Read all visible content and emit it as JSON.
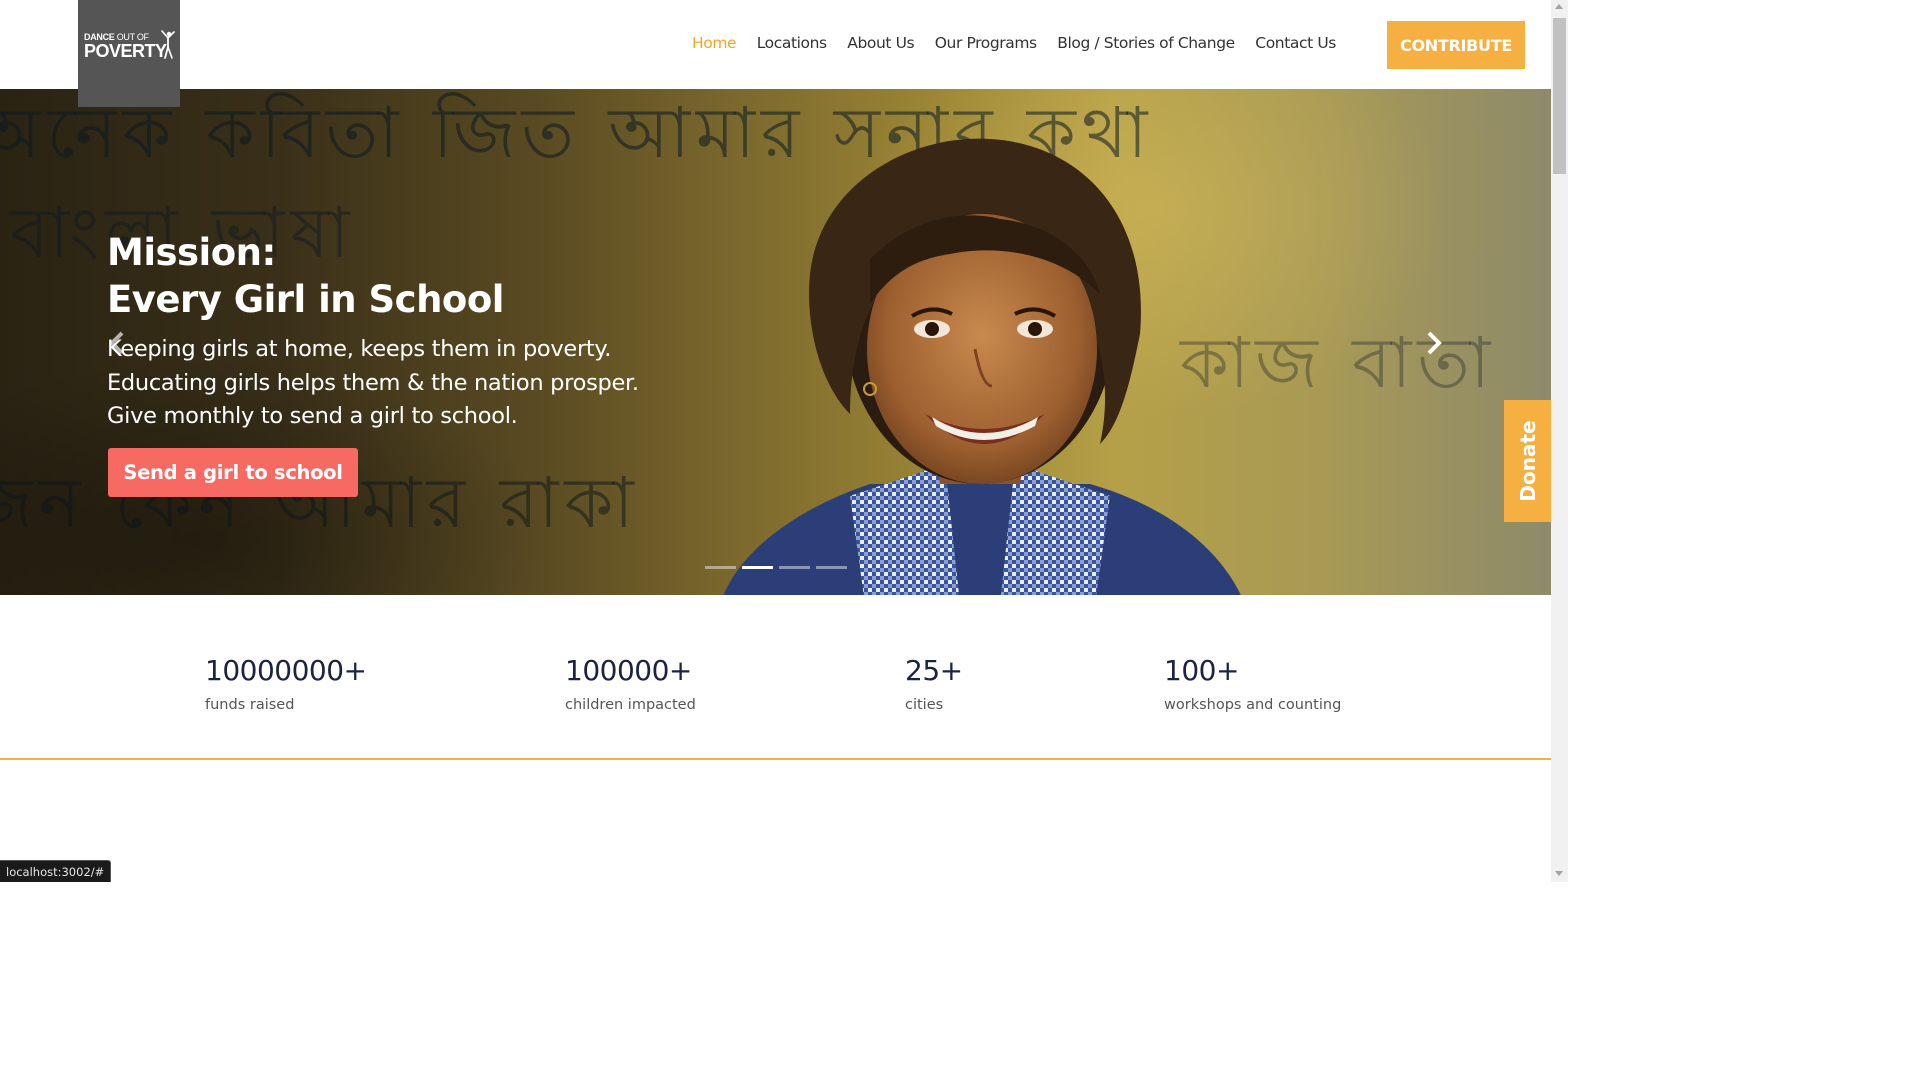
{
  "brand": {
    "logo_line1_bold": "DANCE",
    "logo_line1_thin": " OUT OF",
    "logo_line2": "POVERTY"
  },
  "nav": {
    "items": [
      {
        "label": "Home",
        "active": true
      },
      {
        "label": "Locations",
        "active": false
      },
      {
        "label": "About Us",
        "active": false
      },
      {
        "label": "Our Programs",
        "active": false
      },
      {
        "label": "Blog / Stories of Change",
        "active": false
      },
      {
        "label": "Contact Us",
        "active": false
      }
    ],
    "contribute_label": "CONTRIBUTE"
  },
  "hero": {
    "title_line1": "Mission:",
    "title_line2": "Every Girl in School",
    "text_line1": "Keeping girls at home, keeps them in poverty.",
    "text_line2": "Educating girls helps them & the nation prosper.",
    "text_line3": "Give monthly to send a girl to school.",
    "cta_label": "Send a girl to school",
    "slides_count": 4,
    "active_slide": 2,
    "prev_icon": "chevron-left-icon",
    "next_icon": "chevron-right-icon"
  },
  "donate_tab": {
    "label": "Donate"
  },
  "stats": [
    {
      "value": "10000000+",
      "label": "funds raised"
    },
    {
      "value": "100000+",
      "label": "children impacted"
    },
    {
      "value": "25+",
      "label": "cities"
    },
    {
      "value": "100+",
      "label": "workshops and counting"
    }
  ],
  "status_bar": {
    "url": "localhost:3002/#"
  },
  "colors": {
    "accent_orange": "#f5b041",
    "active_nav": "#f5a623",
    "cta_coral": "#f76a63",
    "stat_navy": "#1c2340",
    "logo_gray": "#555555"
  }
}
